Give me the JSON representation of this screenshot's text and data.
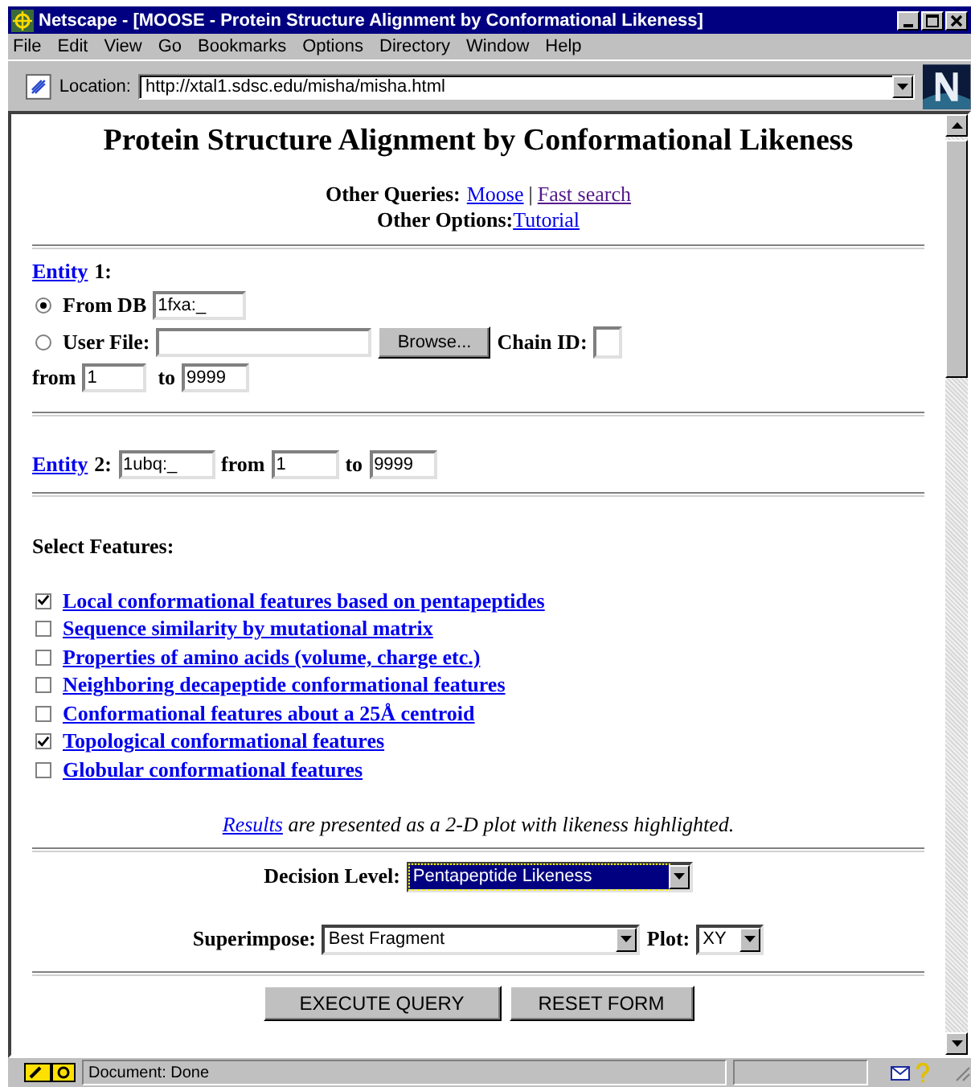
{
  "window": {
    "title": "Netscape - [MOOSE - Protein Structure Alignment by Conformational Likeness]"
  },
  "menu": [
    "File",
    "Edit",
    "View",
    "Go",
    "Bookmarks",
    "Options",
    "Directory",
    "Window",
    "Help"
  ],
  "location": {
    "label": "Location:",
    "url": "http://xtal1.sdsc.edu/misha/misha.html"
  },
  "page": {
    "heading": "Protein Structure Alignment by Conformational Likeness",
    "other_queries": {
      "label": "Other Queries:",
      "links": [
        {
          "text": "Moose",
          "visited": false
        },
        {
          "text": "Fast search",
          "visited": true
        }
      ],
      "separator": "|"
    },
    "other_options": {
      "label": "Other Options:",
      "links": [
        {
          "text": "Tutorial",
          "visited": false
        }
      ]
    },
    "entity1": {
      "link": "Entity",
      "suffix": "1:",
      "from_db": {
        "label": "From DB",
        "selected": true,
        "value": "1fxa:_"
      },
      "user_file": {
        "label": "User File:",
        "selected": false,
        "button": "Browse..."
      },
      "chain_id": {
        "label": "Chain ID:"
      },
      "from": {
        "label": "from",
        "value": "1"
      },
      "to": {
        "label": "to",
        "value": "9999"
      }
    },
    "entity2": {
      "link": "Entity",
      "suffix": "2:",
      "value": "1ubq:_",
      "from": {
        "label": "from",
        "value": "1"
      },
      "to": {
        "label": "to",
        "value": "9999"
      }
    },
    "features": {
      "heading": "Select Features:",
      "items": [
        {
          "label": "Local conformational features based on pentapeptides",
          "checked": true
        },
        {
          "label": "Sequence similarity by mutational matrix",
          "checked": false
        },
        {
          "label": "Properties of amino acids (volume, charge etc.)",
          "checked": false
        },
        {
          "label": "Neighboring decapeptide conformational features",
          "checked": false
        },
        {
          "label": "Conformational features about a 25Å centroid",
          "checked": false
        },
        {
          "label": "Topological conformational features",
          "checked": true
        },
        {
          "label": "Globular conformational features",
          "checked": false
        }
      ]
    },
    "results_note": {
      "link": "Results",
      "text": "are presented as a 2-D plot with likeness highlighted."
    },
    "decision_level": {
      "label": "Decision Level:",
      "value": "Pentapeptide Likeness",
      "focused": true
    },
    "superimpose": {
      "label": "Superimpose:",
      "value": "Best Fragment"
    },
    "plot": {
      "label": "Plot:",
      "value": "XY"
    },
    "buttons": [
      "EXECUTE QUERY",
      "RESET FORM"
    ]
  },
  "status_bar": {
    "text": "Document: Done"
  }
}
